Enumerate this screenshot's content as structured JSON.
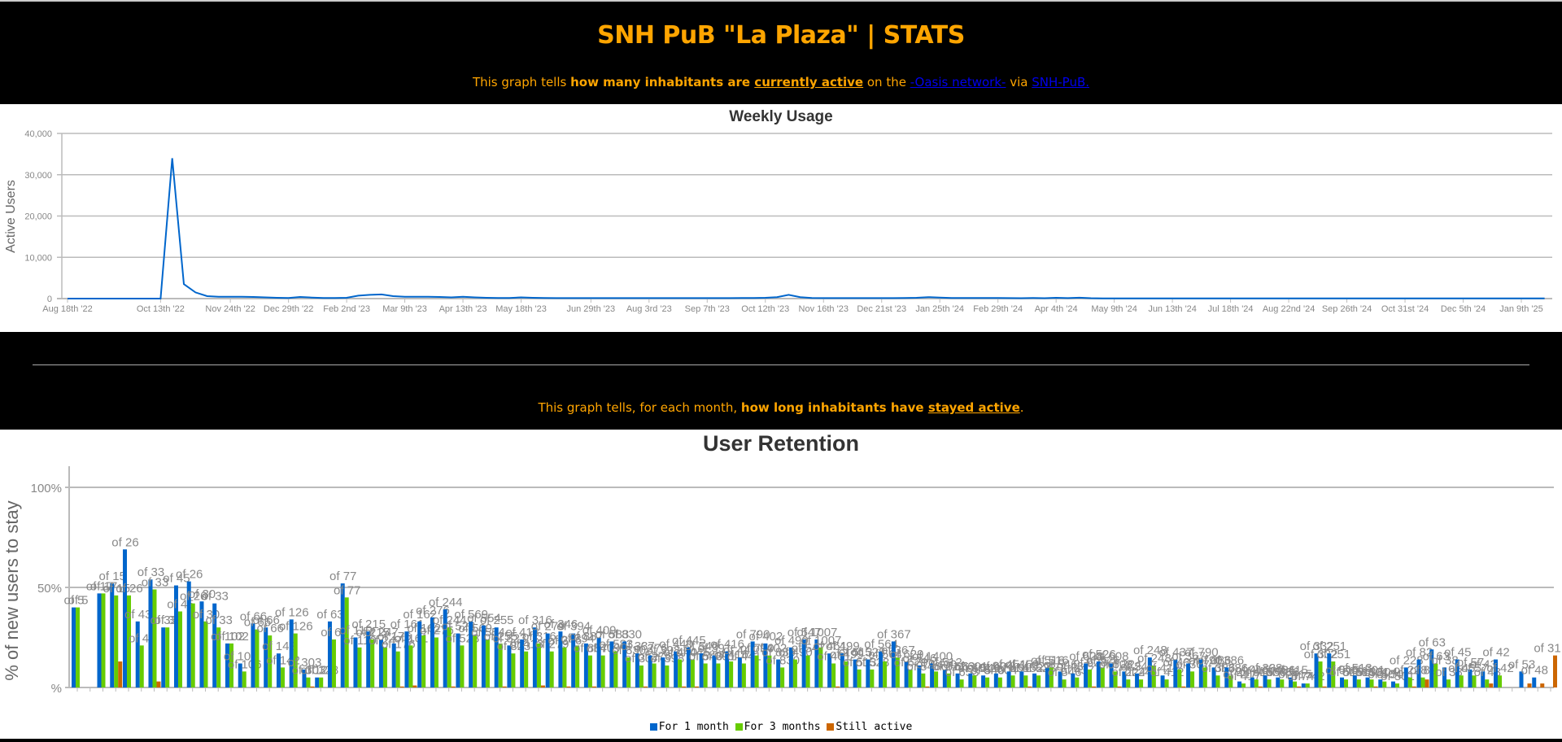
{
  "header": {
    "title": "SNH PuB \"La Plaza\" | STATS",
    "sub1": {
      "t1": "This graph tells ",
      "b1": "how many inhabitants are ",
      "u1": "currently active",
      "t2": " on the ",
      "link1": "-Oasis network-",
      "t3": " via ",
      "link2": "SNH-PuB."
    },
    "sub2": {
      "t1": "This graph tells, for each month, ",
      "b1": "how long inhabitants have ",
      "u1": "stayed active",
      "t2": "."
    }
  },
  "colors": {
    "accent": "#FFA500",
    "link": "#0000ee",
    "line": "#0066cc",
    "one_month": "#0066cc",
    "three_months": "#66cc00",
    "still_active": "#cc6600",
    "grid": "#bbbbbb"
  },
  "chart_data": [
    {
      "type": "line",
      "title": "Weekly Usage",
      "ylabel": "Active Users",
      "xlabel": "",
      "x_interval": "weekly",
      "ylim": [
        0,
        40000
      ],
      "yticks": [
        "0",
        "10,000",
        "20,000",
        "30,000",
        "40,000"
      ],
      "xticks": [
        "Aug 18th '22",
        "Oct 13th '22",
        "Nov 24th '22",
        "Dec 29th '22",
        "Feb 2nd '23",
        "Mar 9th '23",
        "Apr 13th '23",
        "May 18th '23",
        "Jun 29th '23",
        "Aug 3rd '23",
        "Sep 7th '23",
        "Oct 12th '23",
        "Nov 16th '23",
        "Dec 21st '23",
        "Jan 25th '24",
        "Feb 29th '24",
        "Apr 4th '24",
        "May 9th '24",
        "Jun 13th '24",
        "Jul 18th '24",
        "Aug 22nd '24",
        "Sep 26th '24",
        "Oct 31st '24",
        "Dec 5th '24",
        "Jan 9th '25"
      ],
      "xtick_weeks": [
        0,
        8,
        14,
        19,
        24,
        29,
        34,
        39,
        45,
        50,
        55,
        60,
        65,
        70,
        75,
        80,
        85,
        90,
        95,
        100,
        105,
        110,
        115,
        120,
        125
      ],
      "grid": true,
      "values": [
        0,
        0,
        0,
        0,
        0,
        0,
        0,
        0,
        0,
        34000,
        3500,
        1500,
        600,
        450,
        450,
        450,
        400,
        300,
        200,
        150,
        400,
        250,
        150,
        150,
        200,
        700,
        900,
        1000,
        600,
        450,
        450,
        450,
        400,
        300,
        450,
        300,
        200,
        150,
        150,
        300,
        200,
        150,
        120,
        120,
        120,
        120,
        120,
        120,
        120,
        120,
        120,
        120,
        120,
        120,
        120,
        120,
        120,
        120,
        150,
        150,
        200,
        350,
        900,
        350,
        150,
        120,
        120,
        120,
        120,
        120,
        120,
        120,
        150,
        200,
        350,
        250,
        150,
        150,
        150,
        150,
        150,
        120,
        100,
        150,
        100,
        200,
        120,
        220,
        100,
        60,
        50,
        50,
        50,
        50,
        50,
        50,
        50,
        50,
        50,
        50,
        50,
        50,
        50,
        50,
        50,
        50,
        50,
        50,
        50,
        50,
        50,
        50,
        50,
        50,
        50,
        50,
        50,
        50,
        50,
        50,
        50,
        50,
        50,
        50,
        50,
        50,
        50,
        50
      ]
    },
    {
      "type": "bar",
      "title": "User Retention",
      "ylabel": "% of new users to stay",
      "xlabel": "",
      "ylim": [
        0,
        110
      ],
      "yticks": [
        "%",
        "50%",
        "100%"
      ],
      "grid": true,
      "legend": "bottom",
      "series_names": [
        "For 1 month",
        "For 3 months",
        "Still active"
      ],
      "groups": [
        [
          40,
          40,
          0,
          "of 5"
        ],
        null,
        [
          47,
          47,
          0,
          "of 17"
        ],
        [
          52,
          46,
          13,
          "of 15"
        ],
        [
          69,
          46,
          0,
          "of 26"
        ],
        [
          33,
          21,
          0,
          "of 43"
        ],
        [
          54,
          49,
          3,
          "of 33"
        ],
        [
          30,
          30,
          0,
          "of 33"
        ],
        [
          51,
          38,
          0,
          "of 45"
        ],
        [
          53,
          42,
          0,
          "of 26"
        ],
        [
          43,
          33,
          0,
          "of 30"
        ],
        [
          42,
          30,
          0,
          "of 33"
        ],
        [
          22,
          22,
          0,
          "of 102"
        ],
        [
          12,
          8,
          0,
          "of 106"
        ],
        [
          32,
          29,
          0,
          "of 66"
        ],
        [
          30,
          26,
          0,
          "of 66"
        ],
        [
          17,
          10,
          0,
          "of 142"
        ],
        [
          34,
          27,
          0,
          "of 126"
        ],
        [
          9,
          5,
          0.5,
          "of 303"
        ],
        [
          5,
          5,
          0,
          "of 128"
        ],
        [
          33,
          24,
          0,
          "of 63"
        ],
        [
          52,
          45,
          0,
          "of 77"
        ],
        [
          25,
          20,
          0,
          "of 110"
        ],
        [
          28,
          24,
          0,
          "of 215"
        ],
        [
          24,
          20,
          0,
          "of 247"
        ],
        [
          22,
          18,
          0.5,
          "of 176"
        ],
        [
          28,
          21,
          1,
          "of 161"
        ],
        [
          33,
          26,
          0,
          "of 162"
        ],
        [
          35,
          25,
          0,
          "of 276"
        ],
        [
          39,
          30,
          0.5,
          "of 244"
        ],
        [
          27,
          21,
          0,
          "of 528"
        ],
        [
          33,
          26,
          0,
          "of 569"
        ],
        [
          31,
          24,
          0,
          "of 554"
        ],
        [
          30,
          22,
          0.5,
          "of 255"
        ],
        [
          21,
          17,
          0,
          "of 823"
        ],
        [
          24,
          18,
          0,
          "of 413"
        ],
        [
          30,
          22,
          1,
          "of 316"
        ],
        [
          27,
          18,
          0,
          "of 279"
        ],
        [
          28,
          20,
          0.5,
          "of 346"
        ],
        [
          27,
          21,
          0,
          "of 394"
        ],
        [
          22,
          16,
          0.5,
          "of 887"
        ],
        [
          25,
          16,
          0,
          "of 409"
        ],
        [
          23,
          18,
          0,
          "of 583"
        ],
        [
          23,
          15,
          0,
          "of 830"
        ],
        [
          17,
          11,
          0.5,
          "of 337"
        ],
        [
          16,
          12,
          0,
          "of 276"
        ],
        [
          15,
          11,
          0,
          "of 398"
        ],
        [
          18,
          14,
          0.5,
          "of 440"
        ],
        [
          20,
          14,
          0.5,
          "of 445"
        ],
        [
          17,
          12,
          0,
          "of 540"
        ],
        [
          16,
          12,
          0,
          "of 391"
        ],
        [
          18,
          13,
          0,
          "of 416"
        ],
        [
          15,
          12,
          0,
          "of 441"
        ],
        [
          23,
          16,
          0,
          "of 790"
        ],
        [
          22,
          16,
          0,
          "of 402"
        ],
        [
          14,
          10,
          0,
          "of 830"
        ],
        [
          20,
          14,
          0,
          "of 490"
        ],
        [
          24,
          16,
          0,
          "of 547"
        ],
        [
          24,
          20,
          0,
          "of 1007"
        ],
        [
          17,
          12,
          0.5,
          "of 461"
        ],
        [
          17,
          13,
          0,
          "of 499"
        ],
        [
          14,
          9,
          0,
          "of 513"
        ],
        [
          14,
          9,
          0,
          "of 528"
        ],
        [
          18,
          13,
          0,
          "of 564"
        ],
        [
          23,
          15,
          0,
          "of 367"
        ],
        [
          13,
          9,
          0,
          "of 629"
        ],
        [
          11,
          7,
          0.5,
          "of 546"
        ],
        [
          12,
          8,
          0,
          "of 1400"
        ],
        [
          9,
          7,
          0,
          "of 512"
        ],
        [
          7,
          4,
          0,
          "of 653"
        ],
        [
          7,
          6,
          0,
          "of 601"
        ],
        [
          6,
          5,
          0,
          "of 540"
        ],
        [
          7,
          5,
          0,
          "of 604"
        ],
        [
          8,
          6,
          0,
          "of 451"
        ],
        [
          8,
          6,
          0.5,
          "of 452"
        ],
        [
          7,
          6,
          0,
          "of 523"
        ],
        [
          10,
          10,
          0,
          "of 516"
        ],
        [
          8,
          4,
          0,
          "of 546"
        ],
        [
          7,
          5,
          0,
          "of 437"
        ],
        [
          12,
          9,
          0.5,
          "of 628"
        ],
        [
          13,
          10,
          0,
          "of 526"
        ],
        [
          12,
          8,
          0.5,
          "of 608"
        ],
        [
          8,
          4,
          0,
          "of 224"
        ],
        [
          7,
          4,
          0,
          "of 241"
        ],
        [
          15,
          11,
          0,
          "of 248"
        ],
        [
          6,
          4,
          0,
          "of 412"
        ],
        [
          14,
          9,
          0.5,
          "of 437"
        ],
        [
          12,
          8,
          0,
          "of 367"
        ],
        [
          14,
          10,
          0,
          "of 790"
        ],
        [
          10,
          6,
          0,
          "of 386"
        ],
        [
          10,
          6,
          0,
          "of 386"
        ],
        [
          3,
          2,
          0,
          "of 417"
        ],
        [
          5,
          4,
          0.5,
          "of 415"
        ],
        [
          6,
          4,
          0,
          "of 338"
        ],
        [
          5,
          4,
          0,
          "of 436"
        ],
        [
          5,
          3,
          0.5,
          "of 415"
        ],
        [
          2,
          2,
          0,
          "of 742"
        ],
        [
          17,
          13,
          0.5,
          "of 332"
        ],
        [
          17,
          13,
          0,
          "of 251"
        ],
        [
          5,
          4,
          0,
          "of 515"
        ],
        [
          6,
          4,
          0,
          "of 513"
        ],
        [
          5,
          4,
          0.5,
          "of 501"
        ],
        [
          4,
          3,
          0,
          "of 504"
        ],
        [
          3,
          2,
          0,
          "of 501"
        ],
        [
          10,
          5,
          0.5,
          "of 228"
        ],
        [
          14,
          5,
          4,
          "of 82"
        ],
        [
          19,
          12,
          0,
          "of 63"
        ],
        [
          10,
          4,
          0,
          "of 38"
        ],
        [
          14,
          6,
          0,
          "of 45"
        ],
        [
          9,
          6,
          0,
          "of 57"
        ],
        [
          8,
          4,
          2,
          "of 43"
        ],
        [
          14,
          6,
          0,
          "of 42"
        ],
        null,
        [
          8,
          0,
          2,
          "of 53"
        ],
        [
          5,
          0,
          2,
          "of 48"
        ],
        [
          0,
          0,
          16,
          "of 31"
        ]
      ]
    }
  ]
}
